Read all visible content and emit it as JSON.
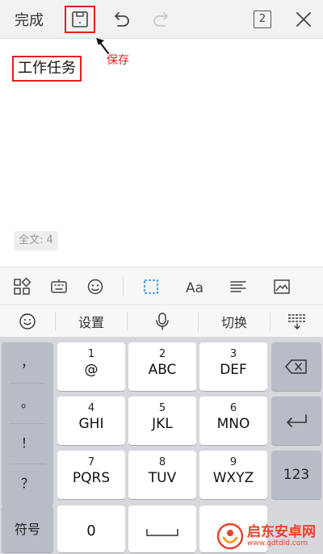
{
  "toolbar": {
    "done_label": "完成",
    "page_count": "2"
  },
  "annotation": {
    "save_label": "保存"
  },
  "document": {
    "title": "工作任务",
    "word_count": "全文: 4"
  },
  "keyboard": {
    "top_bar": {
      "settings": "设置",
      "switch": "切换"
    },
    "punctuation": [
      "，",
      "。",
      "！",
      "？"
    ],
    "keys": [
      {
        "num": "1",
        "letters": "@"
      },
      {
        "num": "2",
        "letters": "ABC"
      },
      {
        "num": "3",
        "letters": "DEF"
      },
      {
        "num": "4",
        "letters": "GHI"
      },
      {
        "num": "5",
        "letters": "JKL"
      },
      {
        "num": "6",
        "letters": "MNO"
      },
      {
        "num": "7",
        "letters": "PQRS"
      },
      {
        "num": "8",
        "letters": "TUV"
      },
      {
        "num": "9",
        "letters": "WXYZ"
      }
    ],
    "numeric_switch": "123",
    "symbols": "符号",
    "zero": "0"
  },
  "watermark": {
    "name": "启东安卓网",
    "url": "www.qdtdld.com"
  },
  "colors": {
    "annotation_red": "#e02020",
    "accent_blue": "#2a8ae0"
  }
}
